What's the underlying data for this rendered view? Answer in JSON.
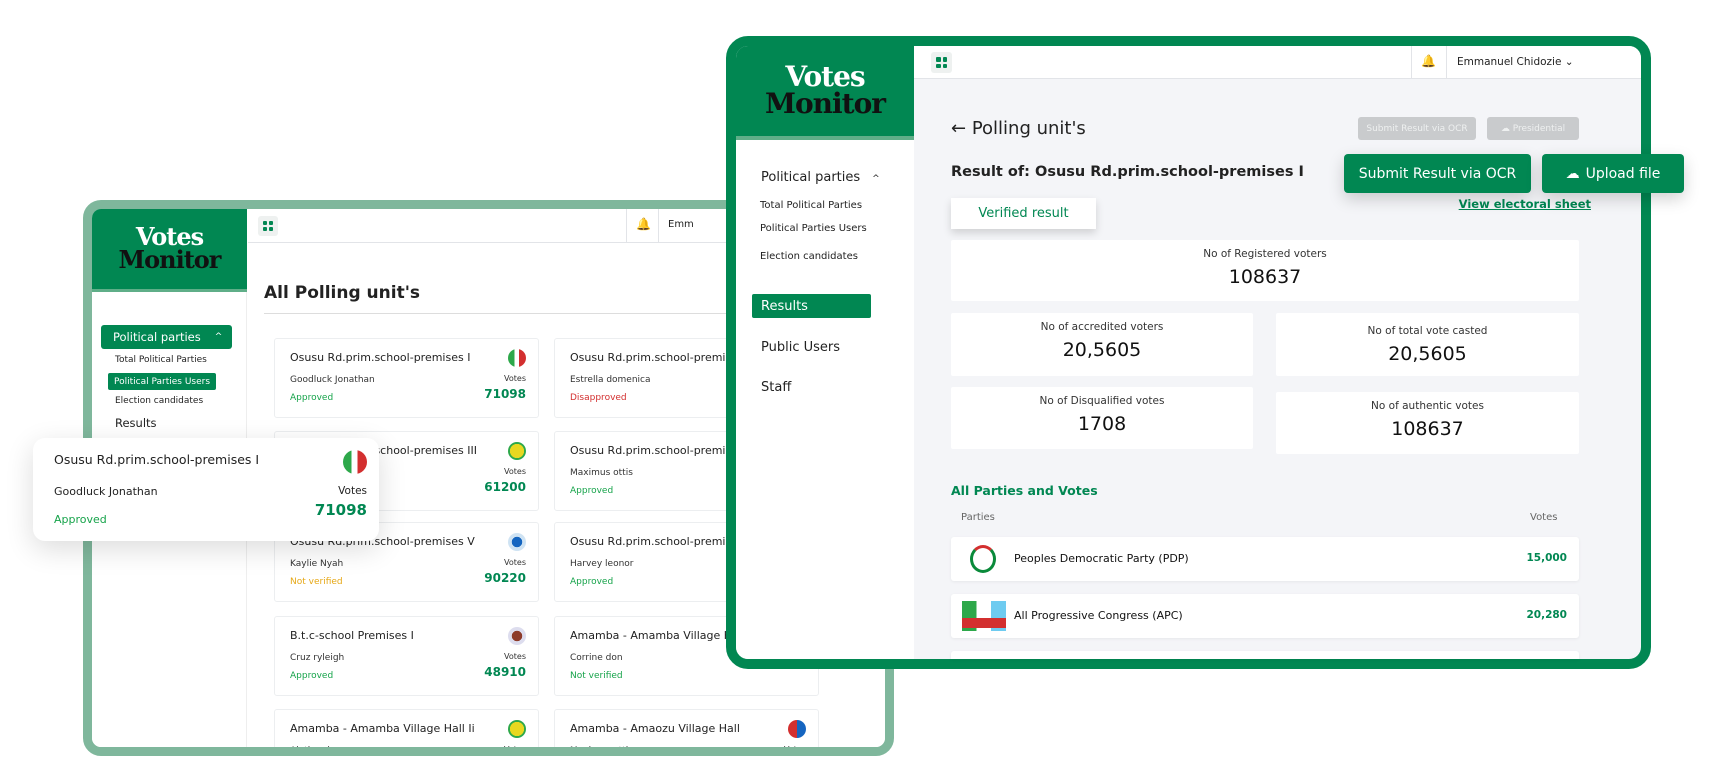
{
  "brand": {
    "line1": "Votes",
    "line2": "Monitor"
  },
  "colors": {
    "primary": "#018752",
    "back_border": "#7fb79c",
    "approved": "#16a34a",
    "disapproved": "#d32f2f",
    "not_verified": "#e6a817"
  },
  "back": {
    "topbar_user_partial": "Emm",
    "sidebar": {
      "group": "Political parties",
      "items": [
        "Total Political Parties",
        "Political Parties Users",
        "Election candidates"
      ],
      "results": "Results"
    },
    "title": "All Polling unit's",
    "cards": [
      {
        "title": "Osusu Rd.prim.school-premises I",
        "name": "Goodluck Jonathan",
        "status": "Approved",
        "votes_label": "Votes",
        "votes": "71098",
        "party_icon": "apc-logo"
      },
      {
        "title": "Osusu Rd.prim.school-premises I",
        "name": "Estrella domenica",
        "status": "Disapproved",
        "party_icon": "pdp-logo"
      },
      {
        "title": "Osusu Rd.prim.school-premises III",
        "name": "",
        "status": "",
        "votes_label": "Votes",
        "votes": "61200",
        "party_icon": "yellow-party-logo"
      },
      {
        "title": "Osusu Rd.prim.school-premises I",
        "name": "Maximus ottis",
        "status": "Approved",
        "party_icon": "pdp-logo"
      },
      {
        "title": "Osusu Rd.prim.school-premises V",
        "name": "Kaylie Nyah",
        "status": "Not verified",
        "votes_label": "Votes",
        "votes": "90220",
        "party_icon": "blue-party-logo"
      },
      {
        "title": "Osusu Rd.prim.school-premises V",
        "name": "Harvey leonor",
        "status": "Approved",
        "party_icon": "pdp-logo"
      },
      {
        "title": "B.t.c-school Premises I",
        "name": "Cruz ryleigh",
        "status": "Approved",
        "votes_label": "Votes",
        "votes": "48910",
        "party_icon": "coat-of-arms-logo"
      },
      {
        "title": "Amamba - Amamba Village Hall I",
        "name": "Corrine don",
        "status": "Not verified",
        "party_icon": "pdp-logo"
      },
      {
        "title": "Amamba - Amamba Village Hall Ii",
        "name": "Aletha alexa",
        "status": "",
        "votes_label": "Votes",
        "votes": "",
        "party_icon": "yellow-party-logo"
      },
      {
        "title": "Amamba - Amaozu Village Hall",
        "name": "Maximus ottis",
        "status": "",
        "votes_label": "Votes",
        "votes": "",
        "party_icon": "red-blue-party-logo"
      }
    ]
  },
  "floating_card": {
    "title": "Osusu Rd.prim.school-premises I",
    "name": "Goodluck Jonathan",
    "status": "Approved",
    "votes_label": "Votes",
    "votes": "71098"
  },
  "front": {
    "topbar": {
      "user": "Emmanuel Chidozie",
      "chevron": "⌄"
    },
    "sidebar": {
      "group": "Political parties",
      "items": [
        "Total Political Parties",
        "Political Parties Users",
        "Election candidates"
      ],
      "results": "Results",
      "public_users": "Public Users",
      "staff": "Staff"
    },
    "title": "Polling unit's",
    "back_arrow": "←",
    "disabled_buttons": {
      "ocr": "Submit Result via OCR",
      "presidential": "Presidential"
    },
    "result_of": "Result of: Osusu Rd.prim.school-premises I",
    "verified_tab": "Verified result",
    "view_sheet": "View electoral sheet",
    "stats": {
      "registered": {
        "label": "No of Registered voters",
        "value": "108637"
      },
      "accredited": {
        "label": "No of accredited voters",
        "value": "20,5605"
      },
      "total_cast": {
        "label": "No of total vote casted",
        "value": "20,5605"
      },
      "disqualified": {
        "label": "No of Disqualified votes",
        "value": "1708"
      },
      "authentic": {
        "label": "No of authentic votes",
        "value": "108637"
      }
    },
    "parties_heading": "All Parties and Votes",
    "table_headers": {
      "parties": "Parties",
      "votes": "Votes"
    },
    "parties": [
      {
        "name": "Peoples Democratic Party (PDP)",
        "votes": "15,000"
      },
      {
        "name": "All Progressive Congress (APC)",
        "votes": "20,280"
      }
    ]
  },
  "actions": {
    "submit_ocr": "Submit Result via OCR",
    "upload": "Upload file"
  }
}
